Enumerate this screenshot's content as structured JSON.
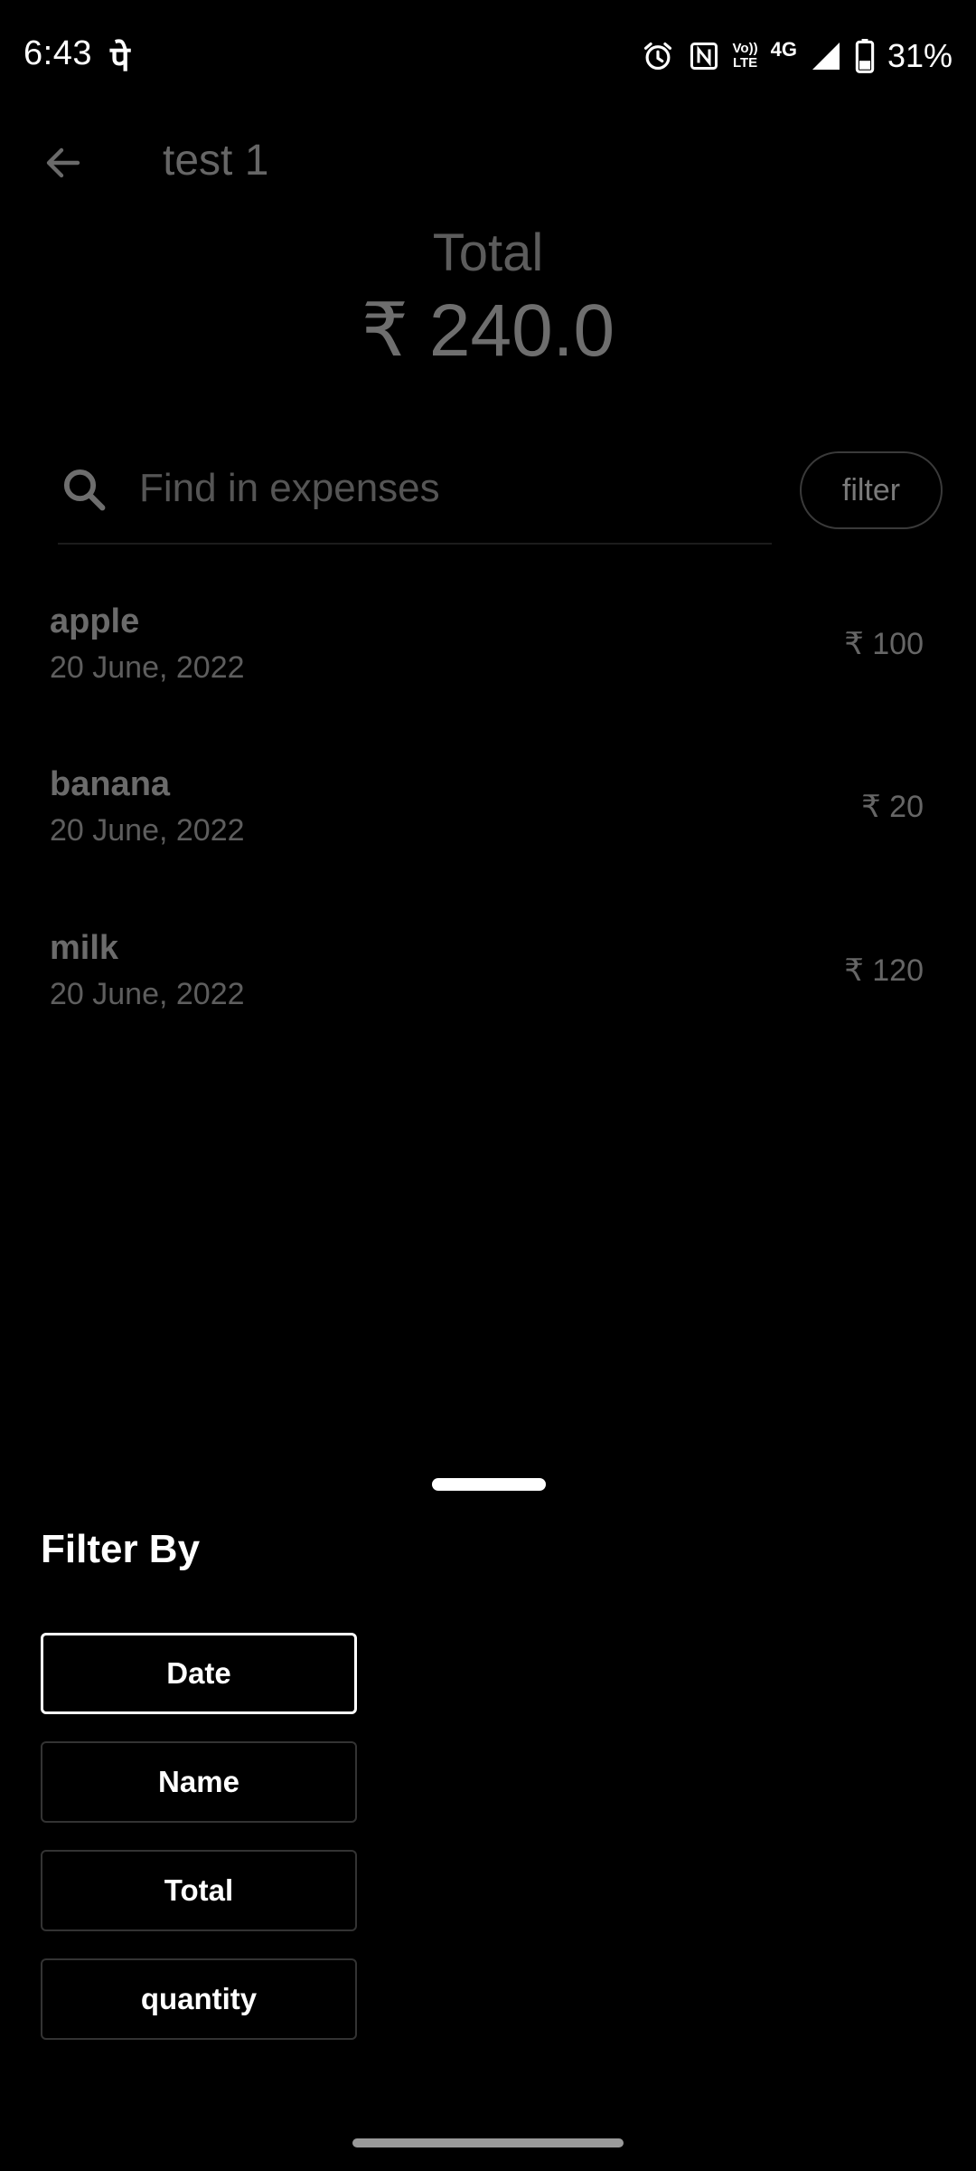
{
  "status_bar": {
    "time": "6:43",
    "pe_glyph": "पे",
    "network": "4G",
    "volte_line1": "Vo))",
    "volte_line2": "LTE",
    "battery": "31%",
    "icons": [
      "alarm-icon",
      "nfc-icon",
      "volte-icon",
      "signal-icon",
      "battery-icon"
    ]
  },
  "app_bar": {
    "back_icon": "arrow-left-icon",
    "title": "test 1"
  },
  "summary": {
    "total_label": "Total",
    "total_value": "₹ 240.0"
  },
  "search": {
    "icon": "search-icon",
    "placeholder": "Find in expenses",
    "value": ""
  },
  "filter_button": {
    "label": "filter"
  },
  "expenses": [
    {
      "name": "apple",
      "date": "20 June, 2022",
      "amount": "₹ 100"
    },
    {
      "name": "banana",
      "date": "20 June, 2022",
      "amount": "₹ 20"
    },
    {
      "name": "milk",
      "date": "20 June, 2022",
      "amount": "₹ 120"
    }
  ],
  "filter_sheet": {
    "title": "Filter By",
    "options": [
      {
        "label": "Date",
        "selected": true
      },
      {
        "label": "Name",
        "selected": false
      },
      {
        "label": "Total",
        "selected": false
      },
      {
        "label": "quantity",
        "selected": false
      }
    ]
  },
  "colors": {
    "background": "#000000",
    "text_primary": "#ffffff",
    "text_dimmed": "#666666"
  }
}
